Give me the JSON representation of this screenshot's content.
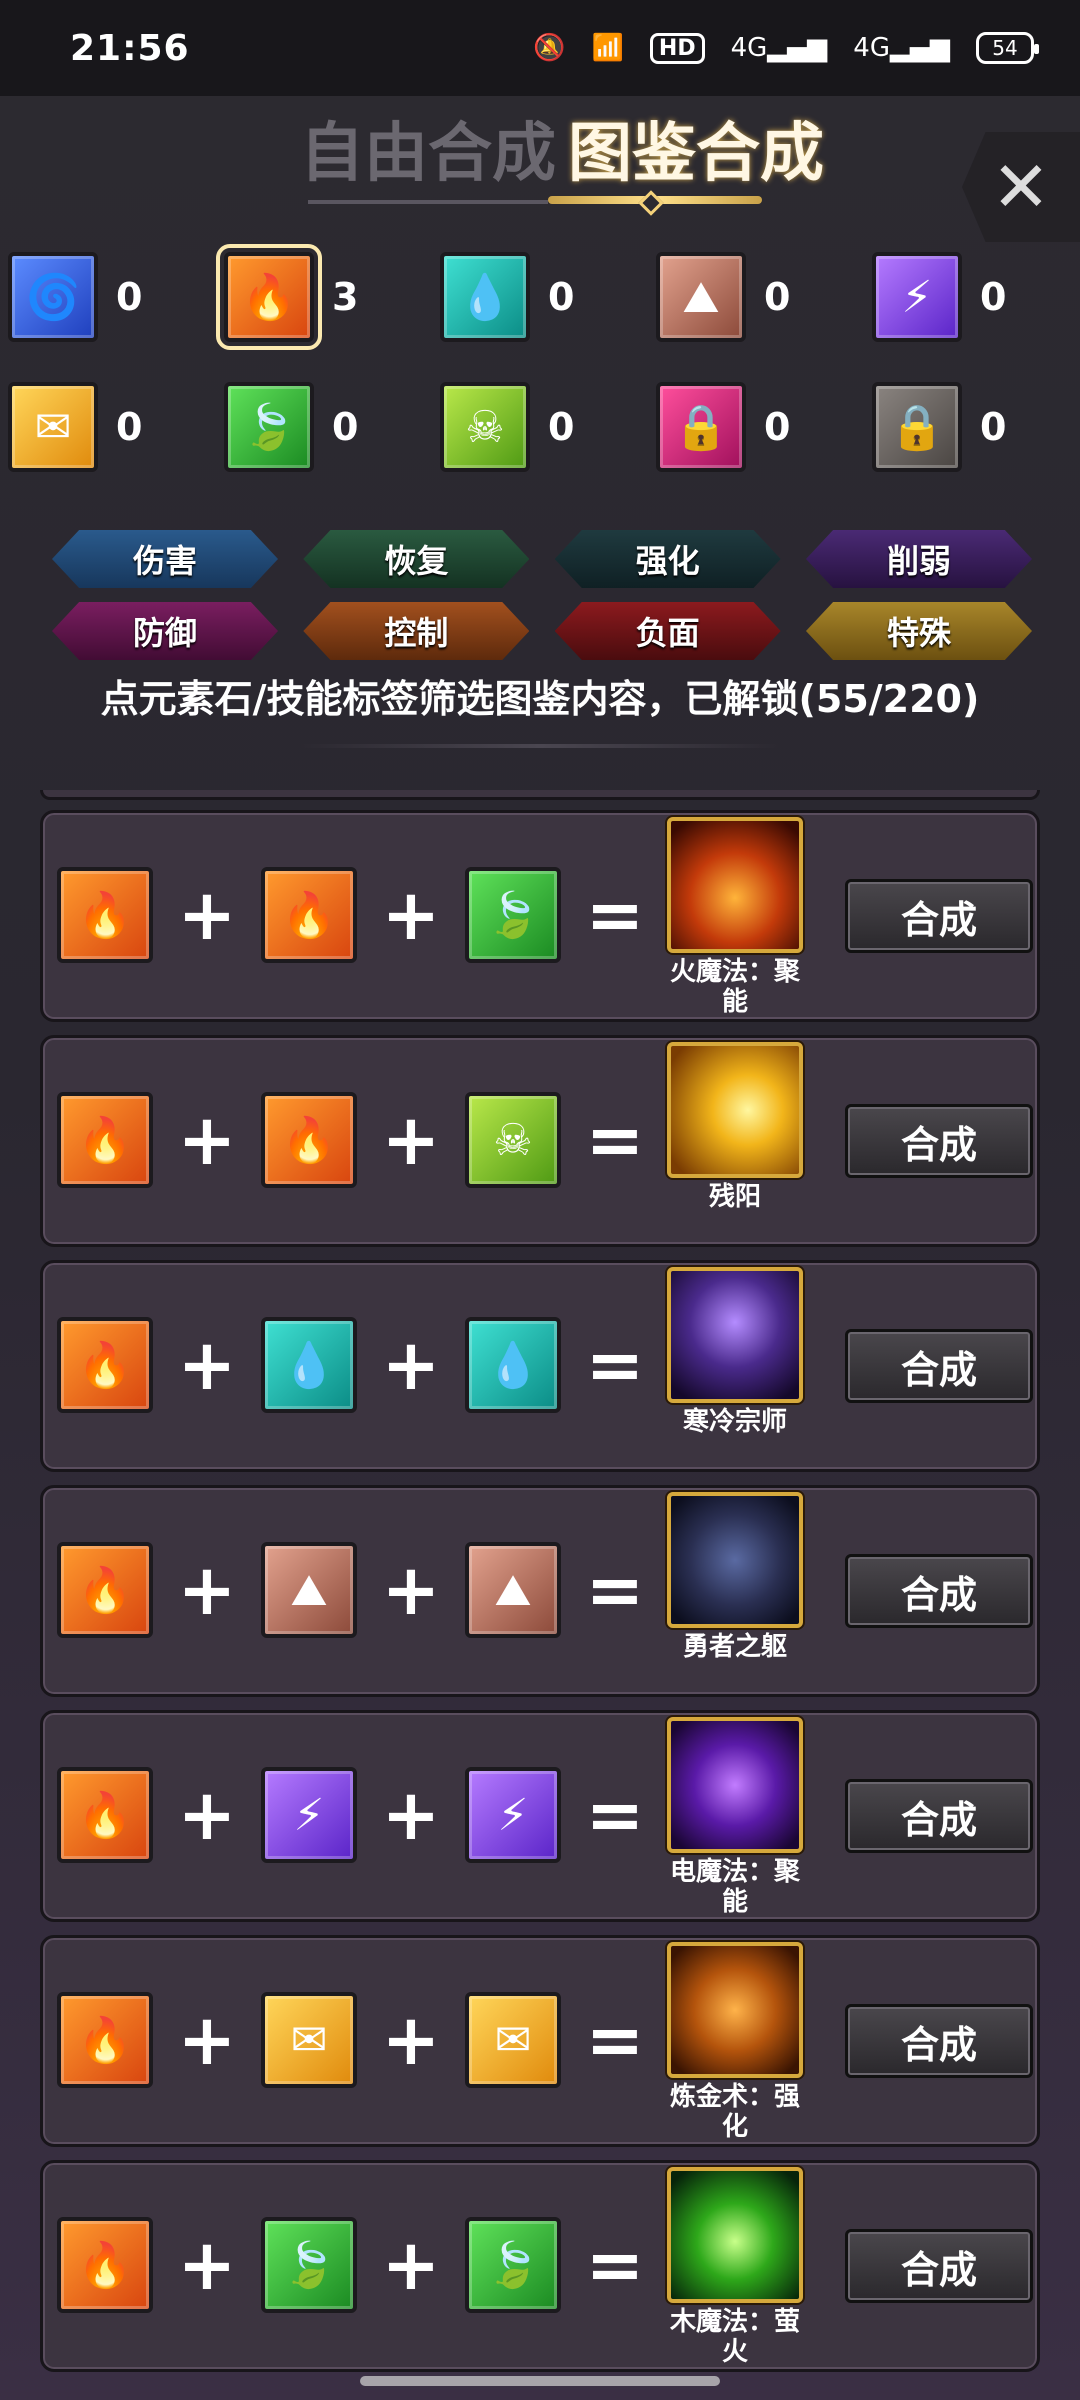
{
  "status": {
    "time": "21:56",
    "hd": "HD",
    "net1": "4G",
    "net2": "4G",
    "battery": "54"
  },
  "header": {
    "tab_free": "自由合成",
    "tab_codex": "图鉴合成",
    "close": "✕"
  },
  "gems": [
    {
      "name": "wind-gem",
      "count": "0",
      "glyph": "🌀",
      "color": "#3a62e6"
    },
    {
      "name": "fire-gem",
      "count": "3",
      "glyph": "🔥",
      "color": "#f06a18",
      "selected": true
    },
    {
      "name": "water-gem",
      "count": "0",
      "glyph": "💧",
      "color": "#1ab5ac"
    },
    {
      "name": "earth-gem",
      "count": "0",
      "glyph": "⛰",
      "color": "#b4705e"
    },
    {
      "name": "thunder-gem",
      "count": "0",
      "glyph": "⚡",
      "color": "#8a4ef0"
    },
    {
      "name": "gold-gem",
      "count": "0",
      "glyph": "✉",
      "color": "#f0b030"
    },
    {
      "name": "wood-gem",
      "count": "0",
      "glyph": "🍃",
      "color": "#32b83a"
    },
    {
      "name": "poison-gem",
      "count": "0",
      "glyph": "☠",
      "color": "#7cc42a"
    },
    {
      "name": "locked-gem-pink",
      "count": "0",
      "glyph": "🔒",
      "color": "#d62878"
    },
    {
      "name": "locked-gem-gray",
      "count": "0",
      "glyph": "🔒",
      "color": "#6a6460"
    }
  ],
  "tags": [
    [
      "伤害",
      "恢复",
      "强化",
      "削弱"
    ],
    [
      "防御",
      "控制",
      "负面",
      "特殊"
    ]
  ],
  "hint": "点元素石/技能标签筛选图鉴内容，已解锁(55/220)",
  "recipes": [
    {
      "inputs": [
        "🔥",
        "🔥",
        "🍃"
      ],
      "result": "火魔法：聚能",
      "button": "合成"
    },
    {
      "inputs": [
        "🔥",
        "🔥",
        "☠"
      ],
      "result": "残阳",
      "button": "合成"
    },
    {
      "inputs": [
        "🔥",
        "💧",
        "💧"
      ],
      "result": "寒冷宗师",
      "button": "合成"
    },
    {
      "inputs": [
        "🔥",
        "⛰",
        "⛰"
      ],
      "result": "勇者之躯",
      "button": "合成"
    },
    {
      "inputs": [
        "🔥",
        "⚡",
        "⚡"
      ],
      "result": "电魔法：聚能",
      "button": "合成"
    },
    {
      "inputs": [
        "🔥",
        "✉",
        "✉"
      ],
      "result": "炼金术：强化",
      "button": "合成"
    },
    {
      "inputs": [
        "🔥",
        "🍃",
        "🍃"
      ],
      "result": "木魔法：萤火",
      "button": "合成"
    }
  ],
  "symbols": {
    "plus": "+",
    "equals": "="
  }
}
